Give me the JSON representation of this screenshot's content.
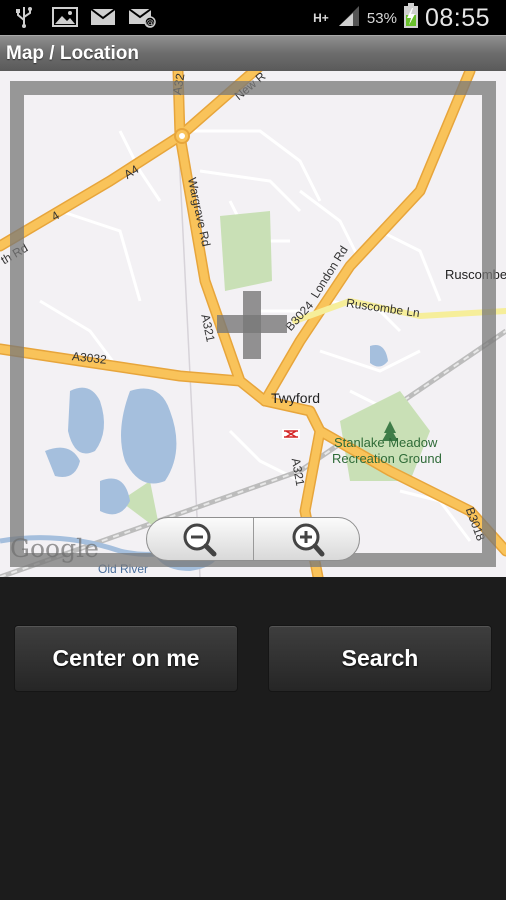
{
  "status": {
    "network": "H+",
    "battery_pct": "53%",
    "time": "08:55",
    "icons": [
      "usb-icon",
      "image-icon",
      "email-icon",
      "gmail-icon",
      "signal-icon",
      "battery-charging-icon"
    ]
  },
  "titlebar": {
    "title": "Map / Location"
  },
  "map": {
    "place_labels": [
      "Twyford",
      "Stanlake Meadow",
      "Recreation Ground",
      "Ruscombe",
      "Old River"
    ],
    "road_labels": [
      "A32",
      "New R",
      "A4",
      "4",
      "Wargrave Rd",
      "London Rd",
      "Ruscombe Ln",
      "B3024",
      "A3032",
      "A321",
      "A321",
      "B3018",
      "th Rd"
    ],
    "watermark": "Google",
    "zoom_out": "zoom-out-icon",
    "zoom_in": "zoom-in-icon"
  },
  "actions": {
    "center_label": "Center on me",
    "search_label": "Search"
  },
  "colors": {
    "major_road": "#f9b54a",
    "water": "#a5bfdd",
    "park": "#c9e0b6",
    "map_bg": "#f3f1f4"
  }
}
